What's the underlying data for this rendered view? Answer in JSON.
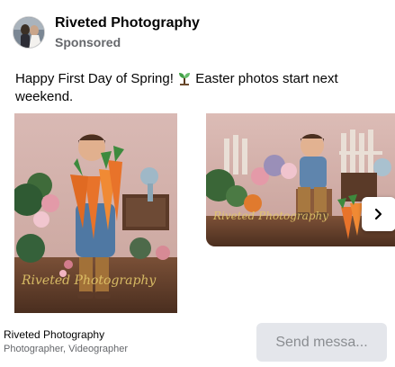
{
  "post": {
    "page_name": "Riveted Photography",
    "sponsored_label": "Sponsored",
    "caption_before": "Happy First Day of Spring! ",
    "caption_after": " Easter photos start next weekend."
  },
  "carousel": {
    "cards": [
      {
        "watermark": "Riveted Photography"
      },
      {
        "watermark": "Riveted Photography"
      }
    ],
    "next_icon": "chevron-right-icon"
  },
  "footer": {
    "business_name": "Riveted Photography",
    "category": "Photographer, Videographer",
    "cta_label": "Send messa..."
  },
  "colors": {
    "text_primary": "#050505",
    "text_secondary": "#65676b",
    "button_bg": "#e4e6eb",
    "button_text": "#8a8d91"
  }
}
